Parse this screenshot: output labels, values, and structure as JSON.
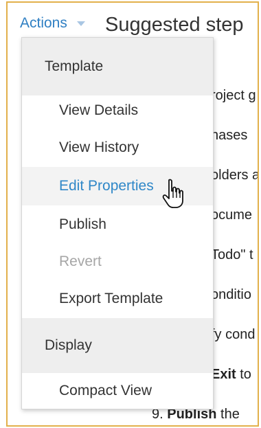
{
  "header": {
    "actions_label": "Actions",
    "page_title": "Suggested step"
  },
  "background_steps": [
    {
      "text": "roject g"
    },
    {
      "text": "hases"
    },
    {
      "text": "olders a"
    },
    {
      "text": "ocume"
    },
    {
      "text": "Todo\" t"
    },
    {
      "text": "onditio"
    },
    {
      "text": "fy cond"
    },
    {
      "bold": "Exit",
      "text": " to"
    },
    {
      "prefix": "9. ",
      "bold": "Publish",
      "text": " the"
    }
  ],
  "menu": {
    "template_section": "Template",
    "items": [
      {
        "label": "View Details"
      },
      {
        "label": "View History"
      },
      {
        "label": "Edit Properties",
        "state": "hovered"
      },
      {
        "label": "Publish"
      },
      {
        "label": "Revert",
        "state": "disabled"
      },
      {
        "label": "Export Template"
      }
    ],
    "display_section": "Display",
    "display_items": [
      {
        "label": "Compact View"
      }
    ]
  },
  "colors": {
    "accent": "#2f7fc3",
    "frame_border": "#e2b04a",
    "disabled_text": "#a6a6a6"
  },
  "icons": {
    "caret": "chevron-down-icon",
    "cursor": "hand-pointer-icon"
  }
}
